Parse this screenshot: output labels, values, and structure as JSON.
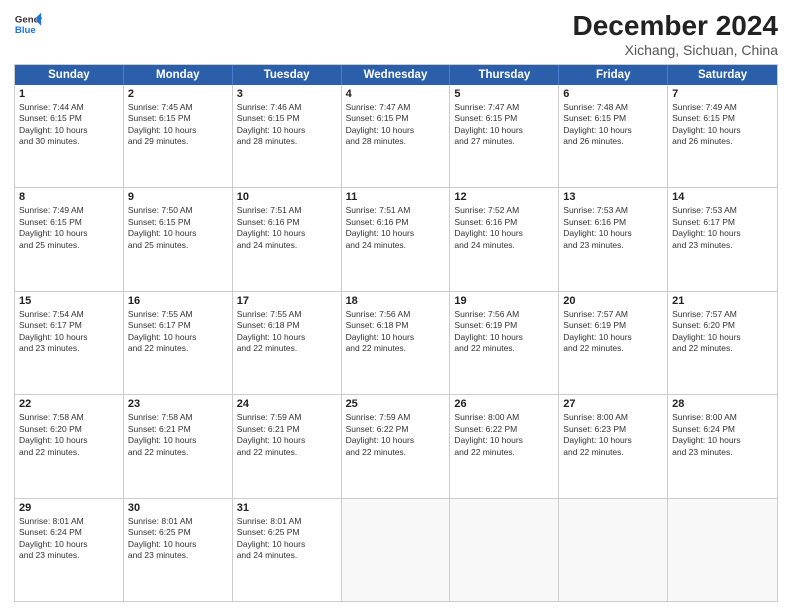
{
  "header": {
    "logo_line1": "General",
    "logo_line2": "Blue",
    "month": "December 2024",
    "location": "Xichang, Sichuan, China"
  },
  "weekdays": [
    "Sunday",
    "Monday",
    "Tuesday",
    "Wednesday",
    "Thursday",
    "Friday",
    "Saturday"
  ],
  "rows": [
    [
      {
        "day": "1",
        "info": "Sunrise: 7:44 AM\nSunset: 6:15 PM\nDaylight: 10 hours\nand 30 minutes."
      },
      {
        "day": "2",
        "info": "Sunrise: 7:45 AM\nSunset: 6:15 PM\nDaylight: 10 hours\nand 29 minutes."
      },
      {
        "day": "3",
        "info": "Sunrise: 7:46 AM\nSunset: 6:15 PM\nDaylight: 10 hours\nand 28 minutes."
      },
      {
        "day": "4",
        "info": "Sunrise: 7:47 AM\nSunset: 6:15 PM\nDaylight: 10 hours\nand 28 minutes."
      },
      {
        "day": "5",
        "info": "Sunrise: 7:47 AM\nSunset: 6:15 PM\nDaylight: 10 hours\nand 27 minutes."
      },
      {
        "day": "6",
        "info": "Sunrise: 7:48 AM\nSunset: 6:15 PM\nDaylight: 10 hours\nand 26 minutes."
      },
      {
        "day": "7",
        "info": "Sunrise: 7:49 AM\nSunset: 6:15 PM\nDaylight: 10 hours\nand 26 minutes."
      }
    ],
    [
      {
        "day": "8",
        "info": "Sunrise: 7:49 AM\nSunset: 6:15 PM\nDaylight: 10 hours\nand 25 minutes."
      },
      {
        "day": "9",
        "info": "Sunrise: 7:50 AM\nSunset: 6:15 PM\nDaylight: 10 hours\nand 25 minutes."
      },
      {
        "day": "10",
        "info": "Sunrise: 7:51 AM\nSunset: 6:16 PM\nDaylight: 10 hours\nand 24 minutes."
      },
      {
        "day": "11",
        "info": "Sunrise: 7:51 AM\nSunset: 6:16 PM\nDaylight: 10 hours\nand 24 minutes."
      },
      {
        "day": "12",
        "info": "Sunrise: 7:52 AM\nSunset: 6:16 PM\nDaylight: 10 hours\nand 24 minutes."
      },
      {
        "day": "13",
        "info": "Sunrise: 7:53 AM\nSunset: 6:16 PM\nDaylight: 10 hours\nand 23 minutes."
      },
      {
        "day": "14",
        "info": "Sunrise: 7:53 AM\nSunset: 6:17 PM\nDaylight: 10 hours\nand 23 minutes."
      }
    ],
    [
      {
        "day": "15",
        "info": "Sunrise: 7:54 AM\nSunset: 6:17 PM\nDaylight: 10 hours\nand 23 minutes."
      },
      {
        "day": "16",
        "info": "Sunrise: 7:55 AM\nSunset: 6:17 PM\nDaylight: 10 hours\nand 22 minutes."
      },
      {
        "day": "17",
        "info": "Sunrise: 7:55 AM\nSunset: 6:18 PM\nDaylight: 10 hours\nand 22 minutes."
      },
      {
        "day": "18",
        "info": "Sunrise: 7:56 AM\nSunset: 6:18 PM\nDaylight: 10 hours\nand 22 minutes."
      },
      {
        "day": "19",
        "info": "Sunrise: 7:56 AM\nSunset: 6:19 PM\nDaylight: 10 hours\nand 22 minutes."
      },
      {
        "day": "20",
        "info": "Sunrise: 7:57 AM\nSunset: 6:19 PM\nDaylight: 10 hours\nand 22 minutes."
      },
      {
        "day": "21",
        "info": "Sunrise: 7:57 AM\nSunset: 6:20 PM\nDaylight: 10 hours\nand 22 minutes."
      }
    ],
    [
      {
        "day": "22",
        "info": "Sunrise: 7:58 AM\nSunset: 6:20 PM\nDaylight: 10 hours\nand 22 minutes."
      },
      {
        "day": "23",
        "info": "Sunrise: 7:58 AM\nSunset: 6:21 PM\nDaylight: 10 hours\nand 22 minutes."
      },
      {
        "day": "24",
        "info": "Sunrise: 7:59 AM\nSunset: 6:21 PM\nDaylight: 10 hours\nand 22 minutes."
      },
      {
        "day": "25",
        "info": "Sunrise: 7:59 AM\nSunset: 6:22 PM\nDaylight: 10 hours\nand 22 minutes."
      },
      {
        "day": "26",
        "info": "Sunrise: 8:00 AM\nSunset: 6:22 PM\nDaylight: 10 hours\nand 22 minutes."
      },
      {
        "day": "27",
        "info": "Sunrise: 8:00 AM\nSunset: 6:23 PM\nDaylight: 10 hours\nand 22 minutes."
      },
      {
        "day": "28",
        "info": "Sunrise: 8:00 AM\nSunset: 6:24 PM\nDaylight: 10 hours\nand 23 minutes."
      }
    ],
    [
      {
        "day": "29",
        "info": "Sunrise: 8:01 AM\nSunset: 6:24 PM\nDaylight: 10 hours\nand 23 minutes."
      },
      {
        "day": "30",
        "info": "Sunrise: 8:01 AM\nSunset: 6:25 PM\nDaylight: 10 hours\nand 23 minutes."
      },
      {
        "day": "31",
        "info": "Sunrise: 8:01 AM\nSunset: 6:25 PM\nDaylight: 10 hours\nand 24 minutes."
      },
      {
        "day": "",
        "info": ""
      },
      {
        "day": "",
        "info": ""
      },
      {
        "day": "",
        "info": ""
      },
      {
        "day": "",
        "info": ""
      }
    ]
  ]
}
